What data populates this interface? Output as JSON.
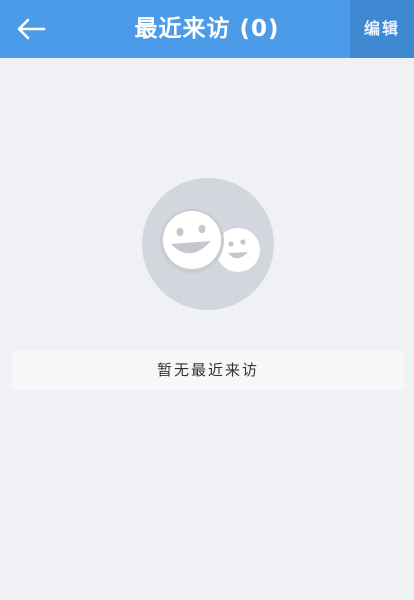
{
  "header": {
    "back_icon": "arrow-left-icon",
    "title": "最近来访 (0)",
    "edit_label": "编辑"
  },
  "empty_state": {
    "icon": "smiley-faces-icon",
    "message": "暂无最近来访"
  },
  "colors": {
    "header_bg": "#4c9be8",
    "edit_bg": "#3f88d2",
    "page_bg": "#f0f1f5",
    "illustration_circle": "#d3d6dc"
  }
}
